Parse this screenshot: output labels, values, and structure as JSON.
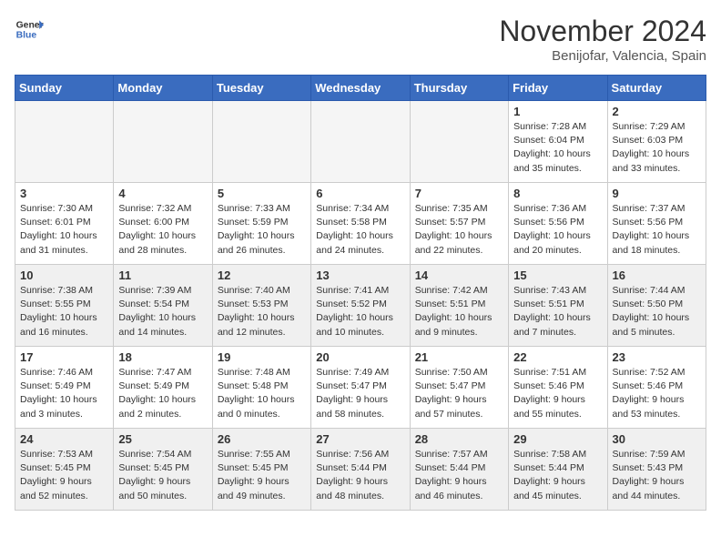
{
  "header": {
    "logo_line1": "General",
    "logo_line2": "Blue",
    "month_title": "November 2024",
    "location": "Benijofar, Valencia, Spain"
  },
  "weekdays": [
    "Sunday",
    "Monday",
    "Tuesday",
    "Wednesday",
    "Thursday",
    "Friday",
    "Saturday"
  ],
  "weeks": [
    [
      {
        "day": "",
        "empty": true
      },
      {
        "day": "",
        "empty": true
      },
      {
        "day": "",
        "empty": true
      },
      {
        "day": "",
        "empty": true
      },
      {
        "day": "",
        "empty": true
      },
      {
        "day": "1",
        "sunrise": "Sunrise: 7:28 AM",
        "sunset": "Sunset: 6:04 PM",
        "daylight": "Daylight: 10 hours and 35 minutes."
      },
      {
        "day": "2",
        "sunrise": "Sunrise: 7:29 AM",
        "sunset": "Sunset: 6:03 PM",
        "daylight": "Daylight: 10 hours and 33 minutes."
      }
    ],
    [
      {
        "day": "3",
        "sunrise": "Sunrise: 7:30 AM",
        "sunset": "Sunset: 6:01 PM",
        "daylight": "Daylight: 10 hours and 31 minutes."
      },
      {
        "day": "4",
        "sunrise": "Sunrise: 7:32 AM",
        "sunset": "Sunset: 6:00 PM",
        "daylight": "Daylight: 10 hours and 28 minutes."
      },
      {
        "day": "5",
        "sunrise": "Sunrise: 7:33 AM",
        "sunset": "Sunset: 5:59 PM",
        "daylight": "Daylight: 10 hours and 26 minutes."
      },
      {
        "day": "6",
        "sunrise": "Sunrise: 7:34 AM",
        "sunset": "Sunset: 5:58 PM",
        "daylight": "Daylight: 10 hours and 24 minutes."
      },
      {
        "day": "7",
        "sunrise": "Sunrise: 7:35 AM",
        "sunset": "Sunset: 5:57 PM",
        "daylight": "Daylight: 10 hours and 22 minutes."
      },
      {
        "day": "8",
        "sunrise": "Sunrise: 7:36 AM",
        "sunset": "Sunset: 5:56 PM",
        "daylight": "Daylight: 10 hours and 20 minutes."
      },
      {
        "day": "9",
        "sunrise": "Sunrise: 7:37 AM",
        "sunset": "Sunset: 5:56 PM",
        "daylight": "Daylight: 10 hours and 18 minutes."
      }
    ],
    [
      {
        "day": "10",
        "sunrise": "Sunrise: 7:38 AM",
        "sunset": "Sunset: 5:55 PM",
        "daylight": "Daylight: 10 hours and 16 minutes."
      },
      {
        "day": "11",
        "sunrise": "Sunrise: 7:39 AM",
        "sunset": "Sunset: 5:54 PM",
        "daylight": "Daylight: 10 hours and 14 minutes."
      },
      {
        "day": "12",
        "sunrise": "Sunrise: 7:40 AM",
        "sunset": "Sunset: 5:53 PM",
        "daylight": "Daylight: 10 hours and 12 minutes."
      },
      {
        "day": "13",
        "sunrise": "Sunrise: 7:41 AM",
        "sunset": "Sunset: 5:52 PM",
        "daylight": "Daylight: 10 hours and 10 minutes."
      },
      {
        "day": "14",
        "sunrise": "Sunrise: 7:42 AM",
        "sunset": "Sunset: 5:51 PM",
        "daylight": "Daylight: 10 hours and 9 minutes."
      },
      {
        "day": "15",
        "sunrise": "Sunrise: 7:43 AM",
        "sunset": "Sunset: 5:51 PM",
        "daylight": "Daylight: 10 hours and 7 minutes."
      },
      {
        "day": "16",
        "sunrise": "Sunrise: 7:44 AM",
        "sunset": "Sunset: 5:50 PM",
        "daylight": "Daylight: 10 hours and 5 minutes."
      }
    ],
    [
      {
        "day": "17",
        "sunrise": "Sunrise: 7:46 AM",
        "sunset": "Sunset: 5:49 PM",
        "daylight": "Daylight: 10 hours and 3 minutes."
      },
      {
        "day": "18",
        "sunrise": "Sunrise: 7:47 AM",
        "sunset": "Sunset: 5:49 PM",
        "daylight": "Daylight: 10 hours and 2 minutes."
      },
      {
        "day": "19",
        "sunrise": "Sunrise: 7:48 AM",
        "sunset": "Sunset: 5:48 PM",
        "daylight": "Daylight: 10 hours and 0 minutes."
      },
      {
        "day": "20",
        "sunrise": "Sunrise: 7:49 AM",
        "sunset": "Sunset: 5:47 PM",
        "daylight": "Daylight: 9 hours and 58 minutes."
      },
      {
        "day": "21",
        "sunrise": "Sunrise: 7:50 AM",
        "sunset": "Sunset: 5:47 PM",
        "daylight": "Daylight: 9 hours and 57 minutes."
      },
      {
        "day": "22",
        "sunrise": "Sunrise: 7:51 AM",
        "sunset": "Sunset: 5:46 PM",
        "daylight": "Daylight: 9 hours and 55 minutes."
      },
      {
        "day": "23",
        "sunrise": "Sunrise: 7:52 AM",
        "sunset": "Sunset: 5:46 PM",
        "daylight": "Daylight: 9 hours and 53 minutes."
      }
    ],
    [
      {
        "day": "24",
        "sunrise": "Sunrise: 7:53 AM",
        "sunset": "Sunset: 5:45 PM",
        "daylight": "Daylight: 9 hours and 52 minutes."
      },
      {
        "day": "25",
        "sunrise": "Sunrise: 7:54 AM",
        "sunset": "Sunset: 5:45 PM",
        "daylight": "Daylight: 9 hours and 50 minutes."
      },
      {
        "day": "26",
        "sunrise": "Sunrise: 7:55 AM",
        "sunset": "Sunset: 5:45 PM",
        "daylight": "Daylight: 9 hours and 49 minutes."
      },
      {
        "day": "27",
        "sunrise": "Sunrise: 7:56 AM",
        "sunset": "Sunset: 5:44 PM",
        "daylight": "Daylight: 9 hours and 48 minutes."
      },
      {
        "day": "28",
        "sunrise": "Sunrise: 7:57 AM",
        "sunset": "Sunset: 5:44 PM",
        "daylight": "Daylight: 9 hours and 46 minutes."
      },
      {
        "day": "29",
        "sunrise": "Sunrise: 7:58 AM",
        "sunset": "Sunset: 5:44 PM",
        "daylight": "Daylight: 9 hours and 45 minutes."
      },
      {
        "day": "30",
        "sunrise": "Sunrise: 7:59 AM",
        "sunset": "Sunset: 5:43 PM",
        "daylight": "Daylight: 9 hours and 44 minutes."
      }
    ]
  ]
}
